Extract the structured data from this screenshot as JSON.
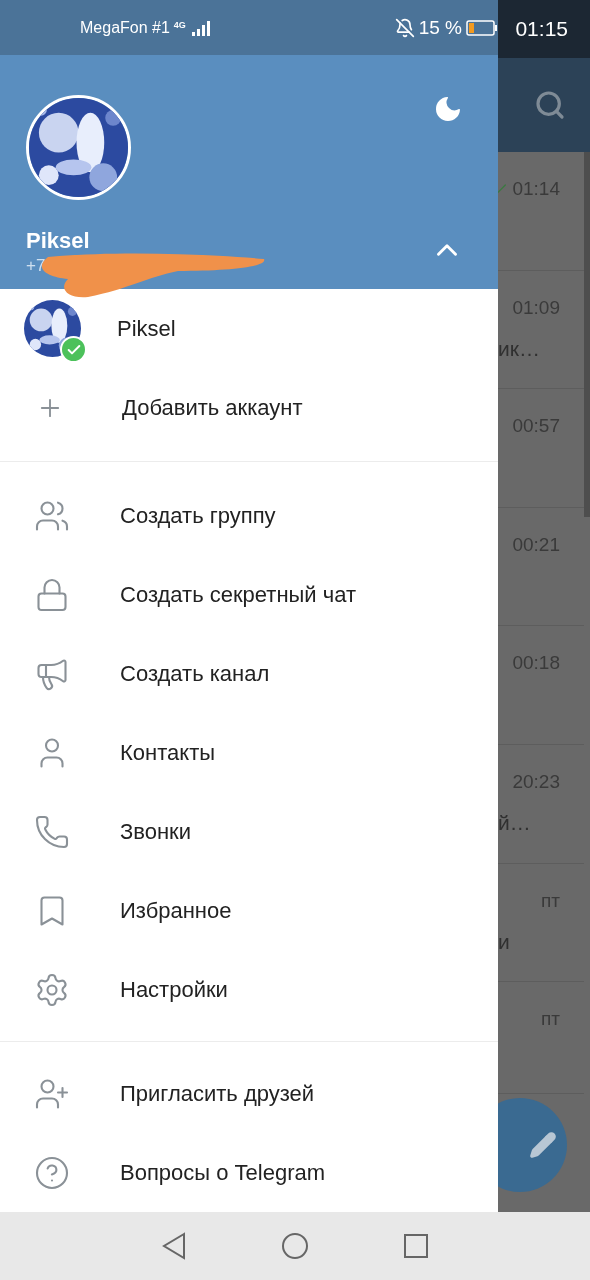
{
  "status_bar": {
    "carrier": "MegaFon #1",
    "network": "4G",
    "battery": "15 %",
    "time": "01:15"
  },
  "header": {
    "name": "Piksel",
    "phone": "+7",
    "accounts_expanded": true
  },
  "accounts": [
    {
      "name": "Piksel",
      "selected": true
    }
  ],
  "add_account": "Добавить аккаунт",
  "menu": [
    {
      "kind": "group",
      "label": "Создать группу"
    },
    {
      "kind": "secret",
      "label": "Создать секретный чат"
    },
    {
      "kind": "channel",
      "label": "Создать канал"
    },
    {
      "kind": "contacts",
      "label": "Контакты"
    },
    {
      "kind": "calls",
      "label": "Звонки"
    },
    {
      "kind": "saved",
      "label": "Избранное"
    },
    {
      "kind": "settings",
      "label": "Настройки"
    }
  ],
  "extra_menu": [
    {
      "kind": "invite",
      "label": "Пригласить друзей"
    },
    {
      "kind": "faq",
      "label": "Вопросы о Telegram"
    }
  ],
  "chat_list": [
    {
      "time": "01:14",
      "read": true
    },
    {
      "time": "01:09",
      "read": false,
      "preview": "ик…"
    },
    {
      "time": "00:57",
      "read": false
    },
    {
      "time": "00:21",
      "read": false
    },
    {
      "time": "00:18",
      "read": false
    },
    {
      "time": "20:23",
      "read": false,
      "preview": "й…"
    },
    {
      "time": "пт",
      "read": false,
      "preview": "и"
    },
    {
      "time": "пт",
      "read": false
    }
  ]
}
